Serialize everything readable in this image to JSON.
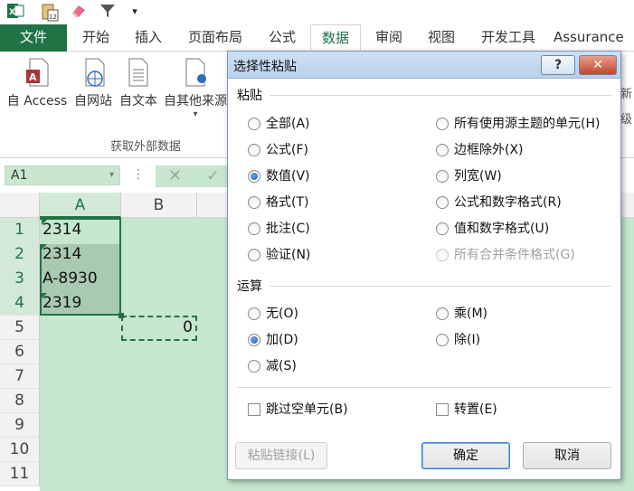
{
  "ribbon_tabs": {
    "file": "文件",
    "home": "开始",
    "insert": "插入",
    "page_layout": "页面布局",
    "formulas": "公式",
    "data": "数据",
    "review": "审阅",
    "view": "视图",
    "developer": "开发工具",
    "assurance": "Assurance"
  },
  "ribbon": {
    "from_access": "自 Access",
    "from_web": "自网站",
    "from_text": "自文本",
    "from_other": "自其他来源",
    "group_label": "获取外部数据",
    "right_partial_1": "新",
    "right_partial_2": "级"
  },
  "formula_bar": {
    "name_box": "A1"
  },
  "grid": {
    "columns": [
      "A",
      "B"
    ],
    "rows": [
      "1",
      "2",
      "3",
      "4",
      "5",
      "6",
      "7",
      "8",
      "9",
      "10",
      "11"
    ],
    "cells": {
      "A1": "2314",
      "A2": "2314",
      "A3": "A-8930",
      "A4": "2319",
      "B5": "0"
    }
  },
  "dialog": {
    "title": "选择性粘贴",
    "help": "?",
    "paste_section": "粘贴",
    "paste_options_left": [
      "全部(A)",
      "公式(F)",
      "数值(V)",
      "格式(T)",
      "批注(C)",
      "验证(N)"
    ],
    "paste_options_right": [
      "所有使用源主题的单元(H)",
      "边框除外(X)",
      "列宽(W)",
      "公式和数字格式(R)",
      "值和数字格式(U)",
      "所有合并条件格式(G)"
    ],
    "paste_selected": "数值(V)",
    "operation_section": "运算",
    "operation_options_left": [
      "无(O)",
      "加(D)",
      "减(S)"
    ],
    "operation_options_right": [
      "乘(M)",
      "除(I)"
    ],
    "operation_selected": "加(D)",
    "skip_blanks": "跳过空单元(B)",
    "transpose": "转置(E)",
    "paste_link": "粘贴链接(L)",
    "ok": "确定",
    "cancel": "取消"
  },
  "colors": {
    "excel_green": "#217346",
    "selection_fill": "#c6e6cd",
    "title_bar": "#cfe0f3",
    "close_red": "#c75050"
  },
  "icons": [
    "excel-icon",
    "paste-icon",
    "eraser-icon",
    "filter-icon",
    "help-icon",
    "close-icon"
  ]
}
